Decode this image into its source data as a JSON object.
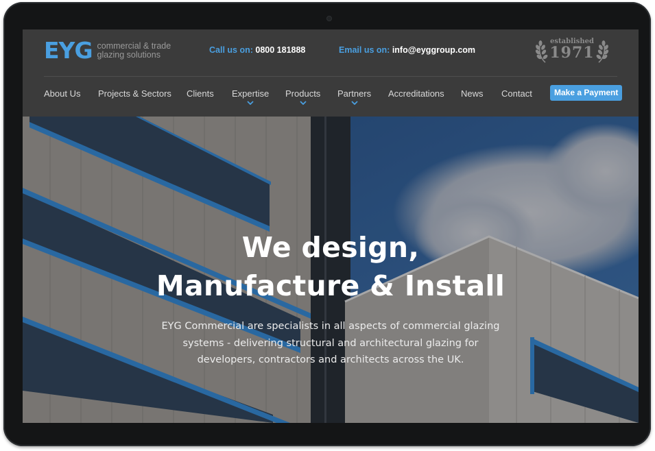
{
  "header": {
    "logo": {
      "mark": "EYG",
      "tagline_line1": "commercial & trade",
      "tagline_line2": "glazing solutions"
    },
    "phone": {
      "label": "Call us on:",
      "value": "0800 181888"
    },
    "email": {
      "label": "Email us on:",
      "value": "info@eyggroup.com"
    },
    "established": {
      "label": "established",
      "year": "1971"
    }
  },
  "nav": {
    "items": [
      {
        "label": "About Us",
        "dropdown": false
      },
      {
        "label": "Projects & Sectors",
        "dropdown": false
      },
      {
        "label": "Clients",
        "dropdown": false
      },
      {
        "label": "Expertise",
        "dropdown": true
      },
      {
        "label": "Products",
        "dropdown": true
      },
      {
        "label": "Partners",
        "dropdown": true
      },
      {
        "label": "Accreditations",
        "dropdown": false
      },
      {
        "label": "News",
        "dropdown": false
      },
      {
        "label": "Contact",
        "dropdown": false
      }
    ],
    "cta": {
      "label": "Make a Payment"
    }
  },
  "hero": {
    "title_line1": "We design,",
    "title_line2": "Manufacture & Install",
    "description": "EYG Commercial are specialists in all aspects of commercial glazing systems - delivering structural and architectural glazing for developers, contractors and architects across the UK."
  },
  "colors": {
    "brand_blue": "#4a9fe0",
    "header_bg": "#3b3b3b",
    "nav_text": "#d9d9d9",
    "device_bezel": "#141516"
  }
}
